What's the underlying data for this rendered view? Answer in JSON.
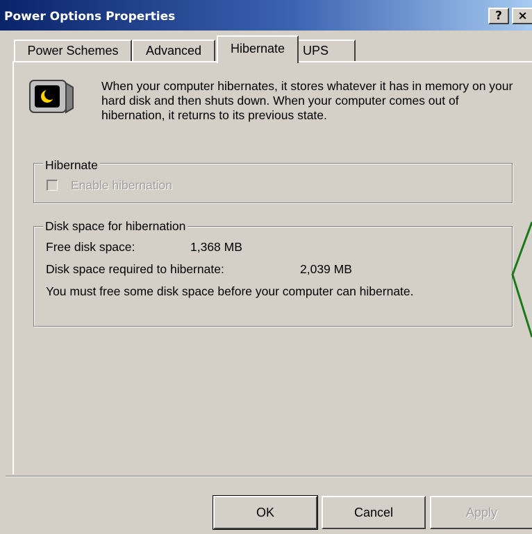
{
  "window": {
    "title": "Power Options Properties",
    "help_label": "?",
    "close_label": "×"
  },
  "tabs": [
    {
      "label": "Power Schemes",
      "active": false
    },
    {
      "label": "Advanced",
      "active": false
    },
    {
      "label": "Hibernate",
      "active": true
    },
    {
      "label": "UPS",
      "active": false
    }
  ],
  "info": {
    "icon": "hibernate-monitor-moon-icon",
    "text": "When your computer hibernates, it stores whatever it has in memory on your hard disk and then shuts down. When your computer comes out of hibernation, it returns to its previous state."
  },
  "hibernate_group": {
    "title": "Hibernate",
    "checkbox_label": "Enable hibernation",
    "checked": false,
    "enabled": false
  },
  "disk_group": {
    "title": "Disk space for hibernation",
    "free_label": "Free disk space:",
    "free_value": "1,368 MB",
    "required_label": "Disk space required to hibernate:",
    "required_value": "2,039 MB",
    "message": "You must free some disk space before your computer can hibernate."
  },
  "buttons": {
    "ok": "OK",
    "cancel": "Cancel",
    "apply": "Apply"
  },
  "colors": {
    "titlebar_start": "#0a246a",
    "face": "#d4d0c8",
    "annotation": "#1a7a1a"
  }
}
